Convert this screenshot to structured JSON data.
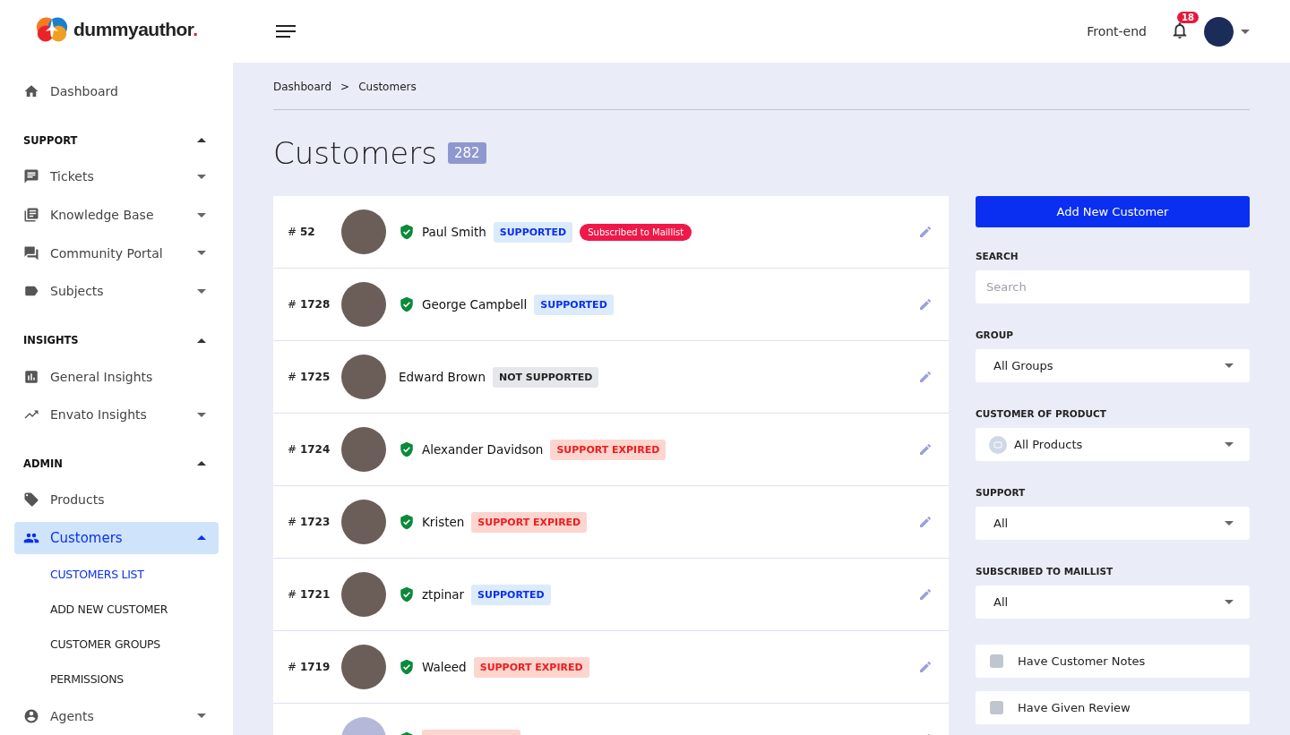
{
  "brand": {
    "name": "dummyauthor",
    "dot": "."
  },
  "sidebar": {
    "top_items": [
      {
        "label": "Dashboard",
        "selected": false
      }
    ],
    "sections": [
      {
        "title": "SUPPORT",
        "expanded": true,
        "items": [
          {
            "label": "Tickets",
            "expanded": false,
            "selected": false
          },
          {
            "label": "Knowledge Base",
            "expanded": false,
            "selected": false
          },
          {
            "label": "Community Portal",
            "expanded": false,
            "selected": false
          },
          {
            "label": "Subjects",
            "expanded": false,
            "selected": false
          }
        ]
      },
      {
        "title": "INSIGHTS",
        "expanded": true,
        "items": [
          {
            "label": "General Insights",
            "selected": false
          },
          {
            "label": "Envato Insights",
            "expanded": false,
            "selected": false
          }
        ]
      },
      {
        "title": "ADMIN",
        "expanded": true,
        "items": [
          {
            "label": "Products",
            "selected": false
          },
          {
            "label": "Customers",
            "expanded": true,
            "selected": true,
            "children": [
              {
                "label": "CUSTOMERS LIST",
                "selected": true
              },
              {
                "label": "ADD NEW CUSTOMER",
                "selected": false
              },
              {
                "label": "CUSTOMER GROUPS",
                "selected": false
              },
              {
                "label": "PERMISSIONS",
                "selected": false
              }
            ]
          },
          {
            "label": "Agents",
            "expanded": false,
            "selected": false
          }
        ]
      }
    ]
  },
  "header": {
    "link": "Front-end",
    "notifications": "18"
  },
  "breadcrumb": [
    "Dashboard",
    ">",
    "Customers"
  ],
  "page": {
    "title": "Customers",
    "count": "282"
  },
  "customers": [
    {
      "id": "# **52**",
      "name": "Paul Smith",
      "verified": true,
      "kind": "photo",
      "badges": [
        {
          "kind": "supported",
          "label": "SUPPORTED"
        },
        {
          "kind": "maillist",
          "label": "Subscribed to Maillist"
        }
      ]
    },
    {
      "id": "# **1728**",
      "name": "George Campbell",
      "verified": true,
      "kind": "photo",
      "badges": [
        {
          "kind": "supported",
          "label": "SUPPORTED"
        }
      ]
    },
    {
      "id": "# **1725**",
      "name": "Edward Brown",
      "verified": false,
      "kind": "photo",
      "badges": [
        {
          "kind": "not_supported",
          "label": "NOT SUPPORTED"
        }
      ]
    },
    {
      "id": "# **1724**",
      "name": "Alexander Davidson",
      "verified": true,
      "kind": "photo",
      "badges": [
        {
          "kind": "expired",
          "label": "SUPPORT EXPIRED"
        }
      ]
    },
    {
      "id": "# **1723**",
      "name": "Kristen",
      "verified": true,
      "kind": "photo",
      "badges": [
        {
          "kind": "expired",
          "label": "SUPPORT EXPIRED"
        }
      ]
    },
    {
      "id": "# **1721**",
      "name": "ztpinar",
      "verified": true,
      "kind": "photo",
      "badges": [
        {
          "kind": "supported",
          "label": "SUPPORTED"
        }
      ]
    },
    {
      "id": "# **1719**",
      "name": "Waleed",
      "verified": true,
      "kind": "photo",
      "badges": [
        {
          "kind": "expired",
          "label": "SUPPORT EXPIRED"
        }
      ]
    },
    {
      "verified": true,
      "kind": "default",
      "badges": [
        {
          "kind": "expired"
        }
      ]
    }
  ],
  "filters": {
    "add_button": "Add New Customer",
    "fields": [
      {
        "kind": "search",
        "label": "SEARCH",
        "placeholder": "Search"
      },
      {
        "kind": "select",
        "label": "GROUP",
        "value": "All Groups"
      },
      {
        "kind": "product_select",
        "label": "CUSTOMER OF PRODUCT",
        "value": "All Products"
      },
      {
        "kind": "select",
        "label": "SUPPORT",
        "value": "All"
      },
      {
        "kind": "select",
        "label": "SUBSCRIBED TO MAILLIST",
        "value": "All"
      }
    ],
    "checkboxes": [
      {
        "label": "Have Customer Notes",
        "checked": false
      },
      {
        "label": "Have Given Review",
        "checked": false
      }
    ]
  }
}
